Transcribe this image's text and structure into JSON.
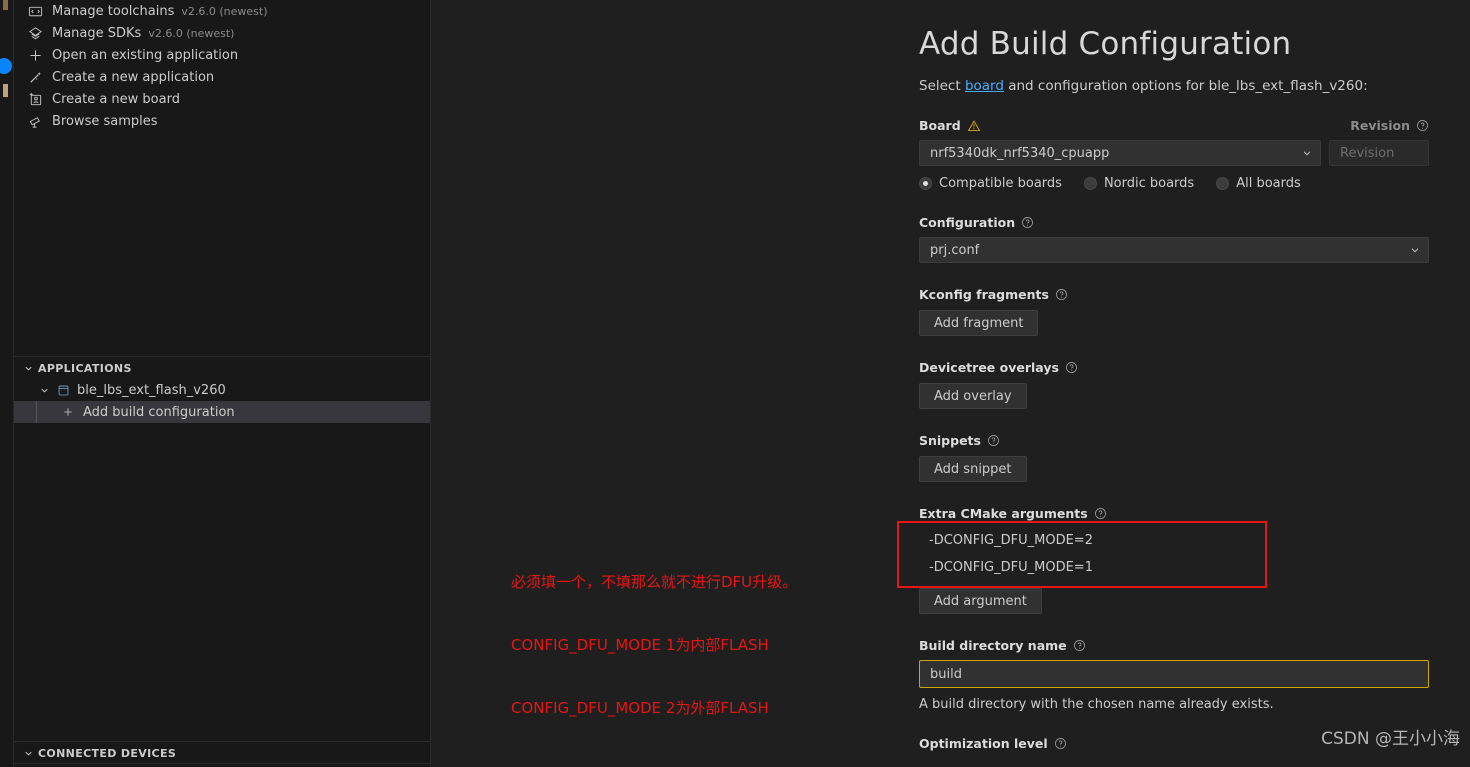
{
  "sidebar": {
    "welcome_items": [
      {
        "icon": "toolchain-icon",
        "label": "Manage toolchains",
        "version": "v2.6.0 (newest)"
      },
      {
        "icon": "sdk-icon",
        "label": "Manage SDKs",
        "version": "v2.6.0 (newest)"
      },
      {
        "icon": "plus-icon",
        "label": "Open an existing application",
        "version": ""
      },
      {
        "icon": "wand-icon",
        "label": "Create a new application",
        "version": ""
      },
      {
        "icon": "new-board-icon",
        "label": "Create a new board",
        "version": ""
      },
      {
        "icon": "telescope-icon",
        "label": "Browse samples",
        "version": ""
      }
    ],
    "applications_section": {
      "title": "APPLICATIONS",
      "app_name": "ble_lbs_ext_flash_v260",
      "add_build_label": "Add build configuration"
    },
    "connected_devices_section": {
      "title": "CONNECTED DEVICES"
    }
  },
  "main": {
    "title": "Add Build Configuration",
    "subtitle_prefix": "Select ",
    "subtitle_link": "board",
    "subtitle_suffix": " and configuration options for ble_lbs_ext_flash_v260:",
    "board": {
      "label": "Board",
      "value": "nrf5340dk_nrf5340_cpuapp",
      "revision_label": "Revision",
      "revision_placeholder": "Revision",
      "filters": [
        {
          "label": "Compatible boards",
          "selected": true
        },
        {
          "label": "Nordic boards",
          "selected": false
        },
        {
          "label": "All boards",
          "selected": false
        }
      ]
    },
    "configuration": {
      "label": "Configuration",
      "value": "prj.conf"
    },
    "kconfig_fragments": {
      "label": "Kconfig fragments",
      "button": "Add fragment"
    },
    "devicetree_overlays": {
      "label": "Devicetree overlays",
      "button": "Add overlay"
    },
    "snippets": {
      "label": "Snippets",
      "button": "Add snippet"
    },
    "extra_cmake_arguments": {
      "label": "Extra CMake arguments",
      "button": "Add argument",
      "arguments": [
        "-DCONFIG_DFU_MODE=2",
        "-DCONFIG_DFU_MODE=1"
      ]
    },
    "build_directory": {
      "label": "Build directory name",
      "value": "build",
      "help_text": "A build directory with the chosen name already exists."
    },
    "optimization_level": {
      "label": "Optimization level"
    }
  },
  "annotation": {
    "line1": "必须填一个，不填那么就不进行DFU升级。",
    "line2": "CONFIG_DFU_MODE 1为内部FLASH",
    "line3": "CONFIG_DFU_MODE 2为外部FLASH"
  },
  "watermark": {
    "text": "CSDN @王小小海"
  },
  "colors": {
    "accent_red": "#e81515",
    "link_blue": "#4daafc",
    "warning_yellow": "#cca700",
    "selection_gray": "#37373d"
  }
}
